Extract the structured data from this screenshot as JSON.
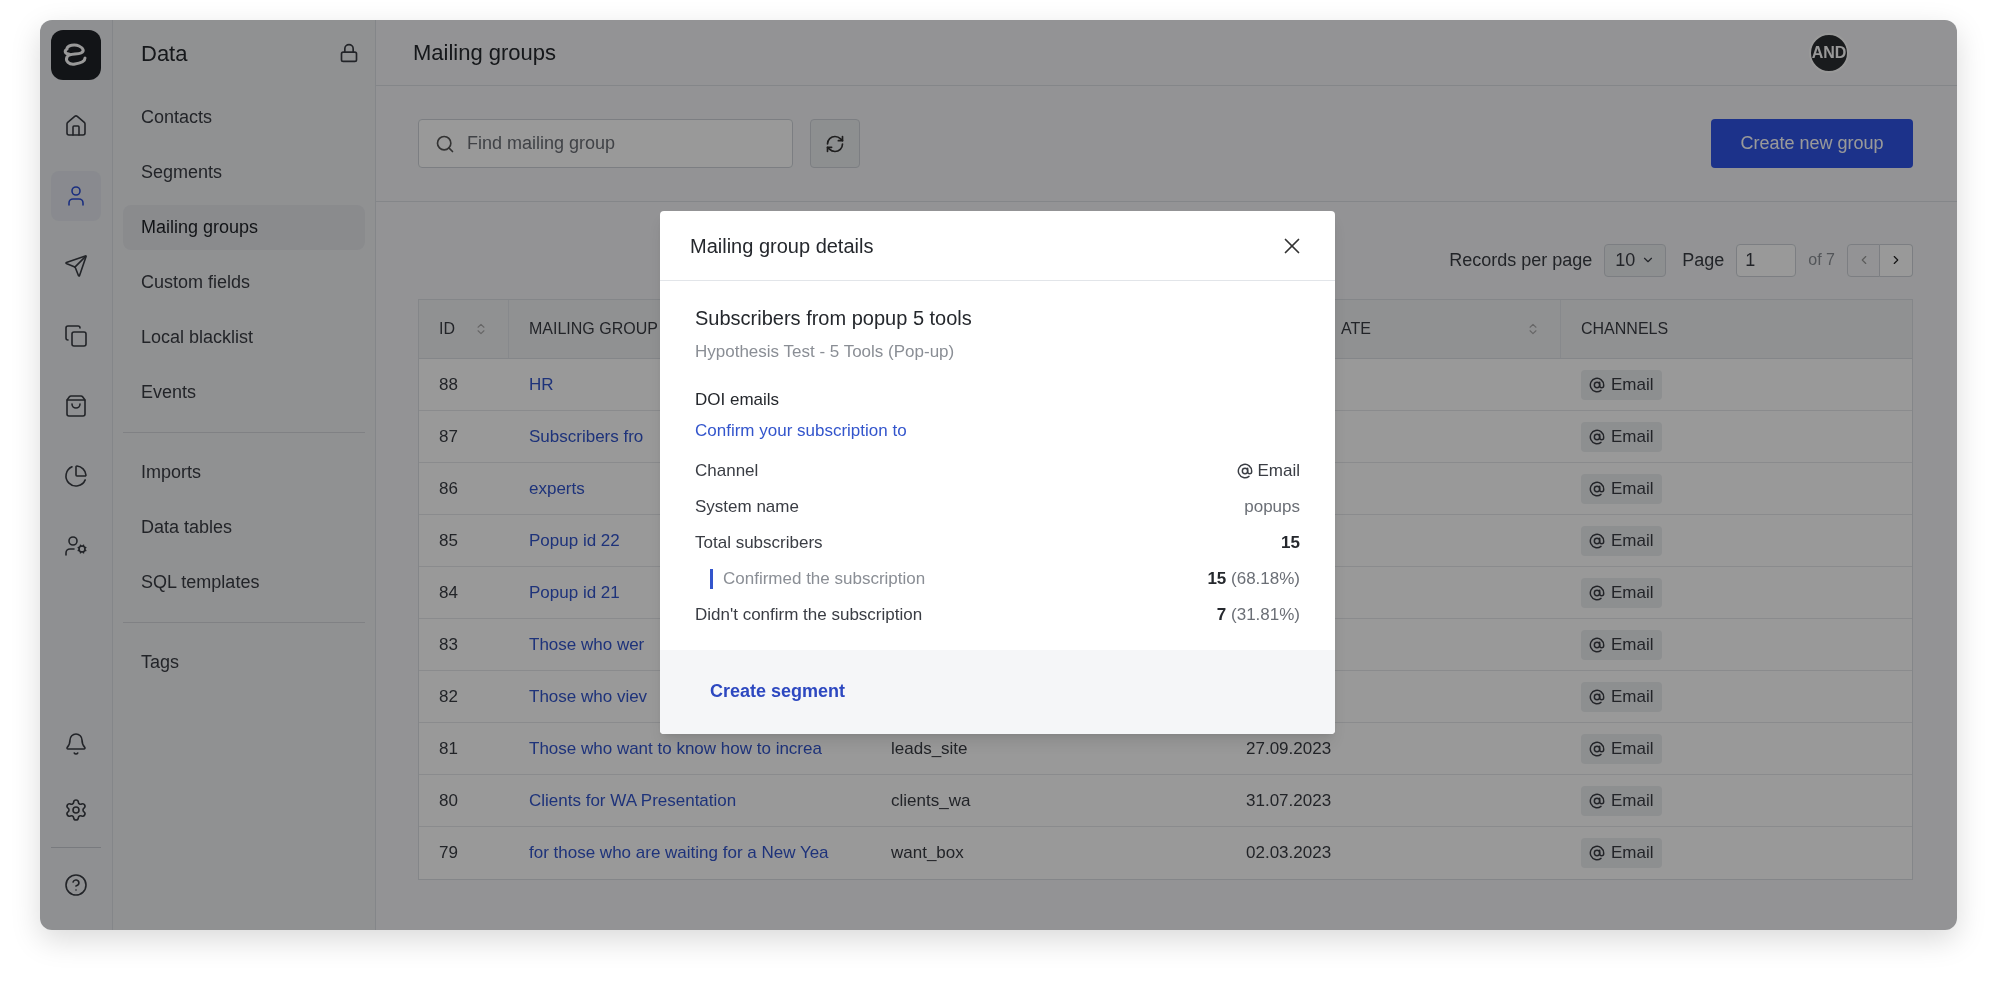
{
  "rail": {
    "top": [
      {
        "kind": "home",
        "selected": false
      },
      {
        "kind": "contacts",
        "selected": true
      },
      {
        "kind": "send",
        "selected": false
      },
      {
        "kind": "copy",
        "selected": false
      },
      {
        "kind": "bag",
        "selected": false
      },
      {
        "kind": "pie",
        "selected": false
      },
      {
        "kind": "user-gear",
        "selected": false
      }
    ],
    "bottom": [
      {
        "kind": "bell",
        "selected": false
      },
      {
        "kind": "settings",
        "selected": false
      }
    ],
    "footer": [
      {
        "kind": "help",
        "selected": false
      }
    ]
  },
  "sidebar": {
    "title": "Data",
    "groups": [
      [
        {
          "label": "Contacts",
          "selected": false
        },
        {
          "label": "Segments",
          "selected": false
        },
        {
          "label": "Mailing groups",
          "selected": true
        },
        {
          "label": "Custom fields",
          "selected": false
        },
        {
          "label": "Local blacklist",
          "selected": false
        },
        {
          "label": "Events",
          "selected": false
        }
      ],
      [
        {
          "label": "Imports",
          "selected": false
        },
        {
          "label": "Data tables",
          "selected": false
        },
        {
          "label": "SQL templates",
          "selected": false
        }
      ],
      [
        {
          "label": "Tags",
          "selected": false
        }
      ]
    ]
  },
  "header": {
    "title": "Mailing groups",
    "avatar": {
      "initials": "AND"
    }
  },
  "toolbar": {
    "search": {
      "placeholder": "Find mailing group"
    },
    "create_button": "Create new group"
  },
  "pagination": {
    "records_label": "Records per page",
    "records_value": "10",
    "page_label": "Page",
    "page_value": "1",
    "page_total": "of 7"
  },
  "table": {
    "columns": [
      {
        "label": "ID",
        "sortable": true
      },
      {
        "label": "MAILING GROUP"
      },
      {},
      {
        "label": "ATE",
        "sortable": true
      },
      {
        "label": "CHANNELS",
        "sortable": false
      }
    ],
    "rows": [
      {
        "id": "88",
        "group": "HR",
        "channel": "Email"
      },
      {
        "id": "87",
        "group": "Subscribers fro",
        "channel": "Email"
      },
      {
        "id": "86",
        "group": "experts",
        "channel": "Email"
      },
      {
        "id": "85",
        "group": "Popup id 22",
        "channel": "Email"
      },
      {
        "id": "84",
        "group": "Popup id 21",
        "channel": "Email"
      },
      {
        "id": "83",
        "group": "Those who wer",
        "channel": "Email"
      },
      {
        "id": "82",
        "group": "Those who viev",
        "channel": "Email"
      },
      {
        "id": "81",
        "group": "Those who want to know how to increa",
        "system_name": "leads_site",
        "date": "27.09.2023",
        "channel": "Email"
      },
      {
        "id": "80",
        "group": "Clients for WA Presentation",
        "system_name": "clients_wa",
        "date": "31.07.2023",
        "channel": "Email"
      },
      {
        "id": "79",
        "group": "for those who are waiting for a New Yea",
        "system_name": "want_box",
        "date": "02.03.2023",
        "channel": "Email"
      }
    ]
  },
  "modal": {
    "title": "Mailing group details",
    "name": "Subscribers from popup 5 tools",
    "subtitle": "Hypothesis Test - 5 Tools (Pop-up)",
    "doi_label": "DOI emails",
    "doi_link": "Confirm your subscription to",
    "stats": [
      {
        "kind": "channel",
        "label": "Channel",
        "value": "Email"
      },
      {
        "kind": "plain",
        "label": "System name",
        "value": "popups"
      },
      {
        "kind": "total",
        "label": "Total subscribers",
        "value": "15"
      },
      {
        "kind": "sub",
        "label": "Confirmed the subscription",
        "value": "**15** (68.18%)"
      },
      {
        "kind": "plain",
        "label": "Didn't confirm the subscription",
        "value": "**7** (31.81%)"
      }
    ],
    "footer_link": "Create segment"
  }
}
